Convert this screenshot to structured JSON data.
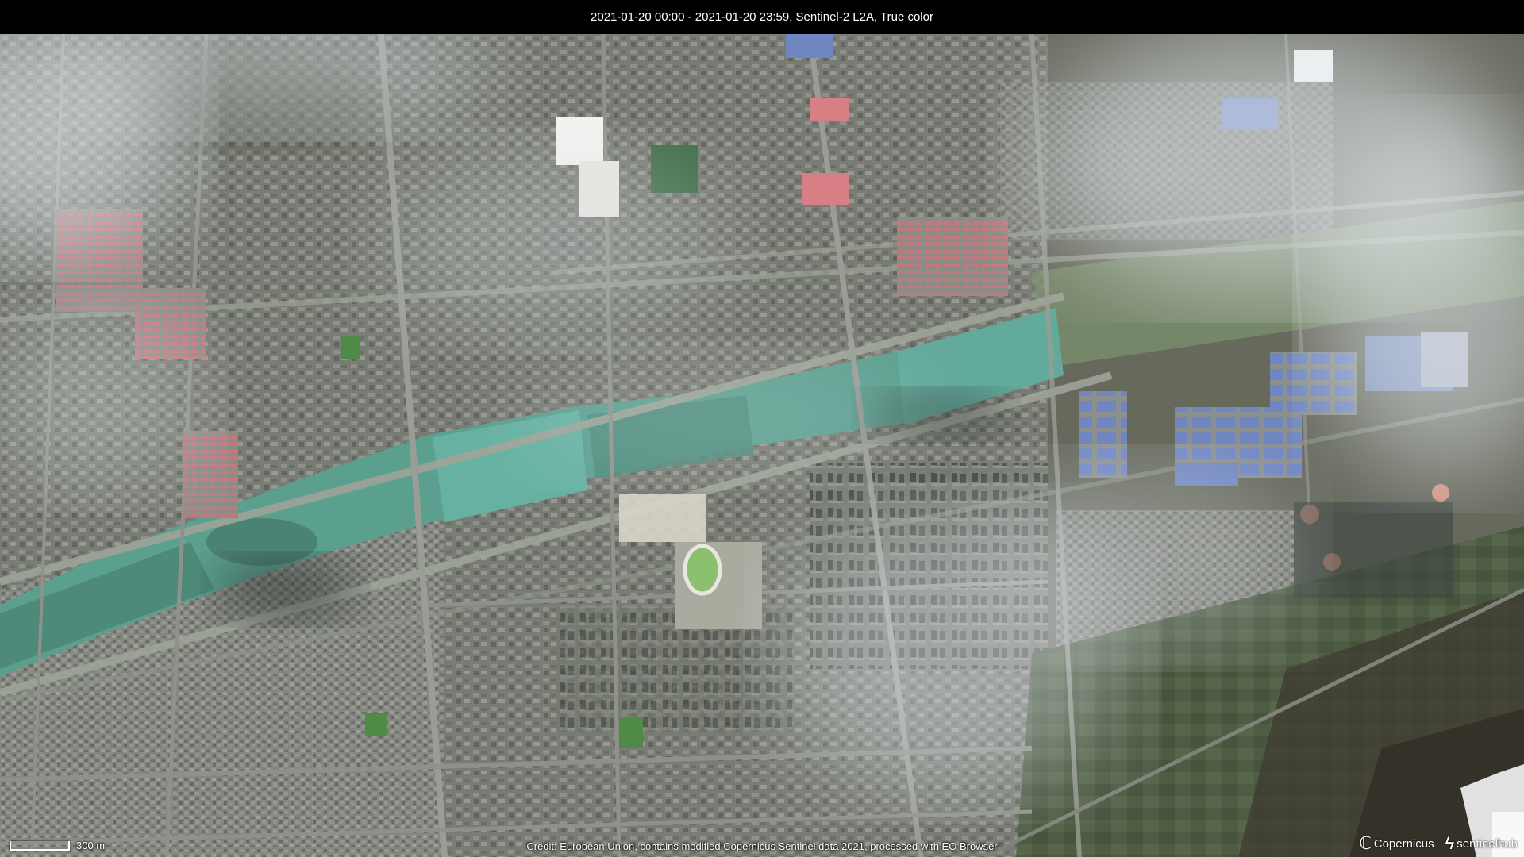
{
  "header": {
    "title": "2021-01-20 00:00 - 2021-01-20 23:59, Sentinel-2 L2A, True color"
  },
  "footer": {
    "credit": "Credit: European Union, contains modified Copernicus Sentinel data 2021, processed with EO Browser"
  },
  "scalebar": {
    "label": "300 m"
  },
  "logos": {
    "copernicus": "Copernicus",
    "sentinelhub": "sentinelhub"
  },
  "colors": {
    "ground": "#5f6654",
    "water": "#5fa394",
    "water_dark": "#4b877a",
    "built": "#8c8d88",
    "field": "#4e5d45",
    "roof_blue": "#6d82b8",
    "roof_red": "#c97a7e",
    "haze": "#dfe6ee"
  }
}
